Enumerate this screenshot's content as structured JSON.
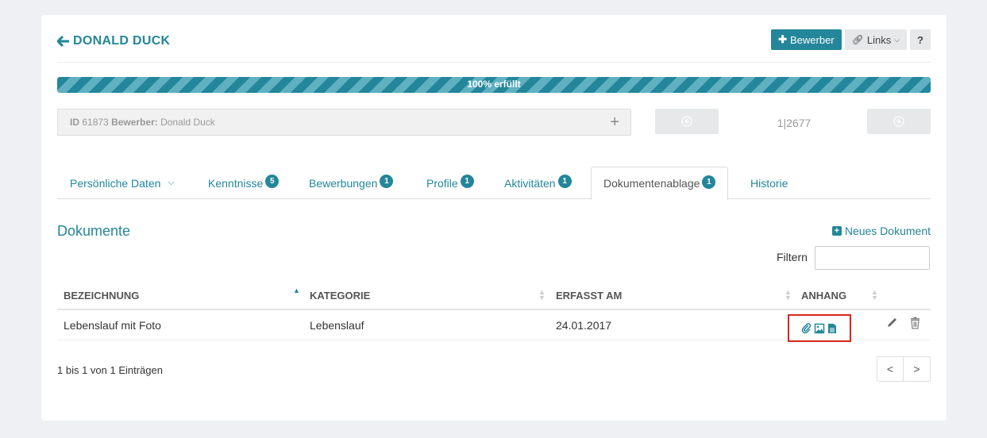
{
  "header": {
    "title": "DONALD DUCK",
    "buttons": {
      "bewerber": "Bewerber",
      "links": "Links",
      "help": "?"
    }
  },
  "progress": {
    "label": "100% erfüllt",
    "percent": 100
  },
  "record": {
    "id_label": "ID",
    "id_value": "61873",
    "bewerber_label": "Bewerber:",
    "bewerber_value": "Donald Duck",
    "counter": "1|2677"
  },
  "tabs": [
    {
      "label": "Persönliche Daten",
      "badge": ""
    },
    {
      "label": "Kenntnisse",
      "badge": "5"
    },
    {
      "label": "Bewerbungen",
      "badge": "1"
    },
    {
      "label": "Profile",
      "badge": "1"
    },
    {
      "label": "Aktivitäten",
      "badge": "1"
    },
    {
      "label": "Dokumentenablage",
      "badge": "1"
    },
    {
      "label": "Historie",
      "badge": ""
    }
  ],
  "section": {
    "title": "Dokumente",
    "new_doc": "Neues Dokument",
    "filter_label": "Filtern",
    "filter_value": ""
  },
  "table": {
    "columns": [
      "BEZEICHNUNG",
      "KATEGORIE",
      "ERFASST AM",
      "ANHANG"
    ],
    "rows": [
      {
        "bezeichnung": "Lebenslauf mit Foto",
        "kategorie": "Lebenslauf",
        "erfasst_am": "24.01.2017"
      }
    ]
  },
  "footer": {
    "info": "1 bis 1 von 1 Einträgen",
    "prev": "<",
    "next": ">"
  },
  "colors": {
    "accent": "#23869a",
    "highlight": "#d9261c"
  }
}
